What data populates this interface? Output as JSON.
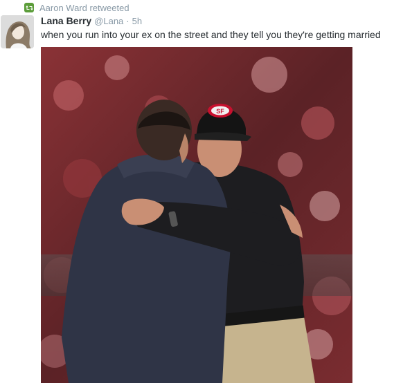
{
  "retweet": {
    "icon": "retweet-icon",
    "label": "Aaron Ward retweeted"
  },
  "tweet": {
    "display_name": "Lana Berry",
    "handle": "@Lana",
    "separator": "·",
    "time": "5h",
    "text": "when you run into your ex on the street and they tell you they're getting married",
    "avatar_icon": "avatar",
    "media": {
      "kind": "photo",
      "cap_logo_text": "SF"
    }
  },
  "colors": {
    "retweet_green": "#5c9d3a",
    "secondary_text": "#8899a6",
    "primary_text": "#292f33",
    "cap_red": "#c8102e"
  }
}
